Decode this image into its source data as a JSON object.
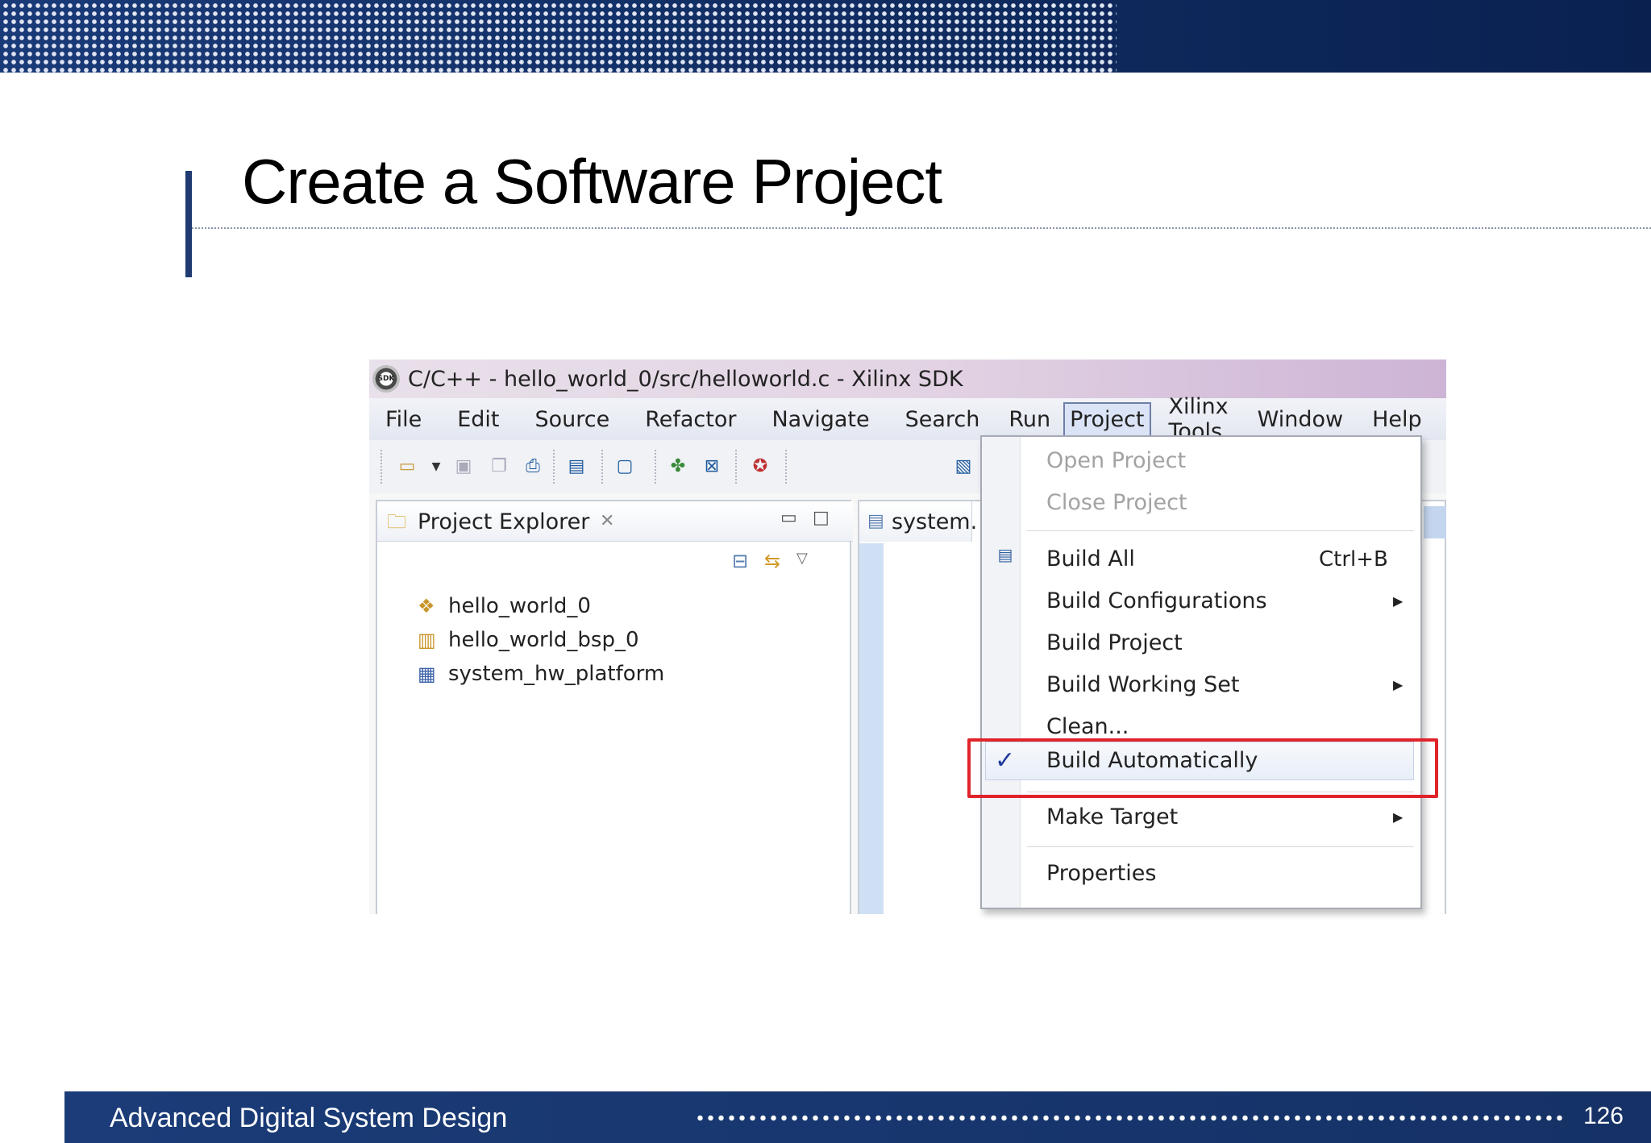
{
  "slide": {
    "title": "Create a Software Project",
    "footer_text": "Advanced Digital System Design",
    "page_number": "126"
  },
  "window": {
    "title": "C/C++ - hello_world_0/src/helloworld.c - Xilinx SDK",
    "logo_text": "SDK"
  },
  "menubar": {
    "items": [
      "File",
      "Edit",
      "Source",
      "Refactor",
      "Navigate",
      "Search",
      "Run",
      "Project",
      "Xilinx Tools",
      "Window",
      "Help"
    ],
    "active": "Project"
  },
  "project_explorer": {
    "tab_label": "Project Explorer",
    "items": [
      "hello_world_0",
      "hello_world_bsp_0",
      "system_hw_platform"
    ]
  },
  "editor": {
    "tab_label": "system."
  },
  "project_menu": {
    "open_project": "Open Project",
    "close_project": "Close Project",
    "build_all": "Build All",
    "build_all_shortcut": "Ctrl+B",
    "build_configurations": "Build Configurations",
    "build_project": "Build Project",
    "build_working_set": "Build Working Set",
    "clean": "Clean...",
    "build_automatically": "Build Automatically",
    "build_automatically_checked": true,
    "make_target": "Make Target",
    "properties": "Properties"
  },
  "colors": {
    "banner": "#1a3a78",
    "highlight": "#e0232a"
  }
}
